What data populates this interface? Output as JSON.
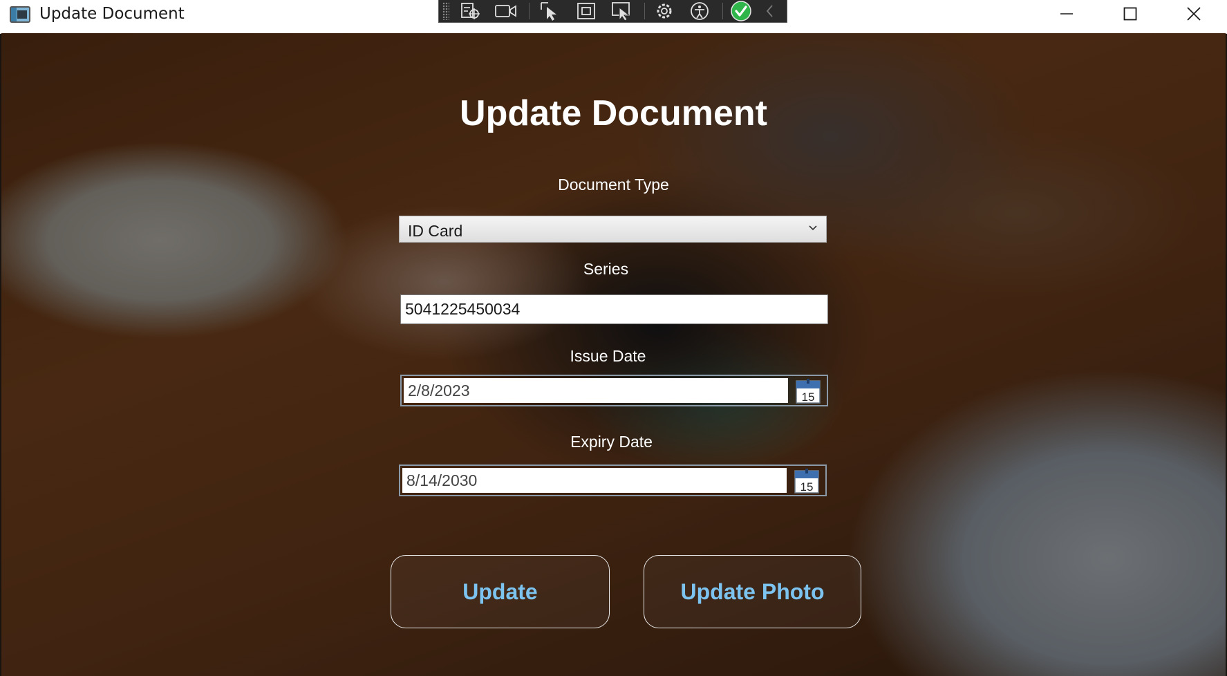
{
  "window": {
    "title": "Update Document",
    "controls": [
      "minimize",
      "maximize",
      "close"
    ]
  },
  "devtools_toolbar": {
    "tools": [
      "live-visual-tree-icon",
      "record-icon",
      "select-element-icon",
      "display-layout-adorners-icon",
      "track-focus-icon",
      "hot-reload-settings-icon",
      "accessibility-icon",
      "binding-ok-icon",
      "collapse-icon"
    ]
  },
  "form": {
    "title": "Update Document",
    "document_type": {
      "label": "Document Type",
      "value": "ID Card"
    },
    "series": {
      "label": "Series",
      "value": "5041225450034"
    },
    "issue_date": {
      "label": "Issue Date",
      "value": "2/8/2023",
      "calendar_day": "15"
    },
    "expiry_date": {
      "label": "Expiry Date",
      "value": "8/14/2030",
      "calendar_day": "15"
    },
    "buttons": {
      "update": "Update",
      "update_photo": "Update Photo"
    }
  },
  "colors": {
    "button_text": "#7cc3ef",
    "title_text": "#ffffff",
    "accept_green": "#2fb54a"
  }
}
